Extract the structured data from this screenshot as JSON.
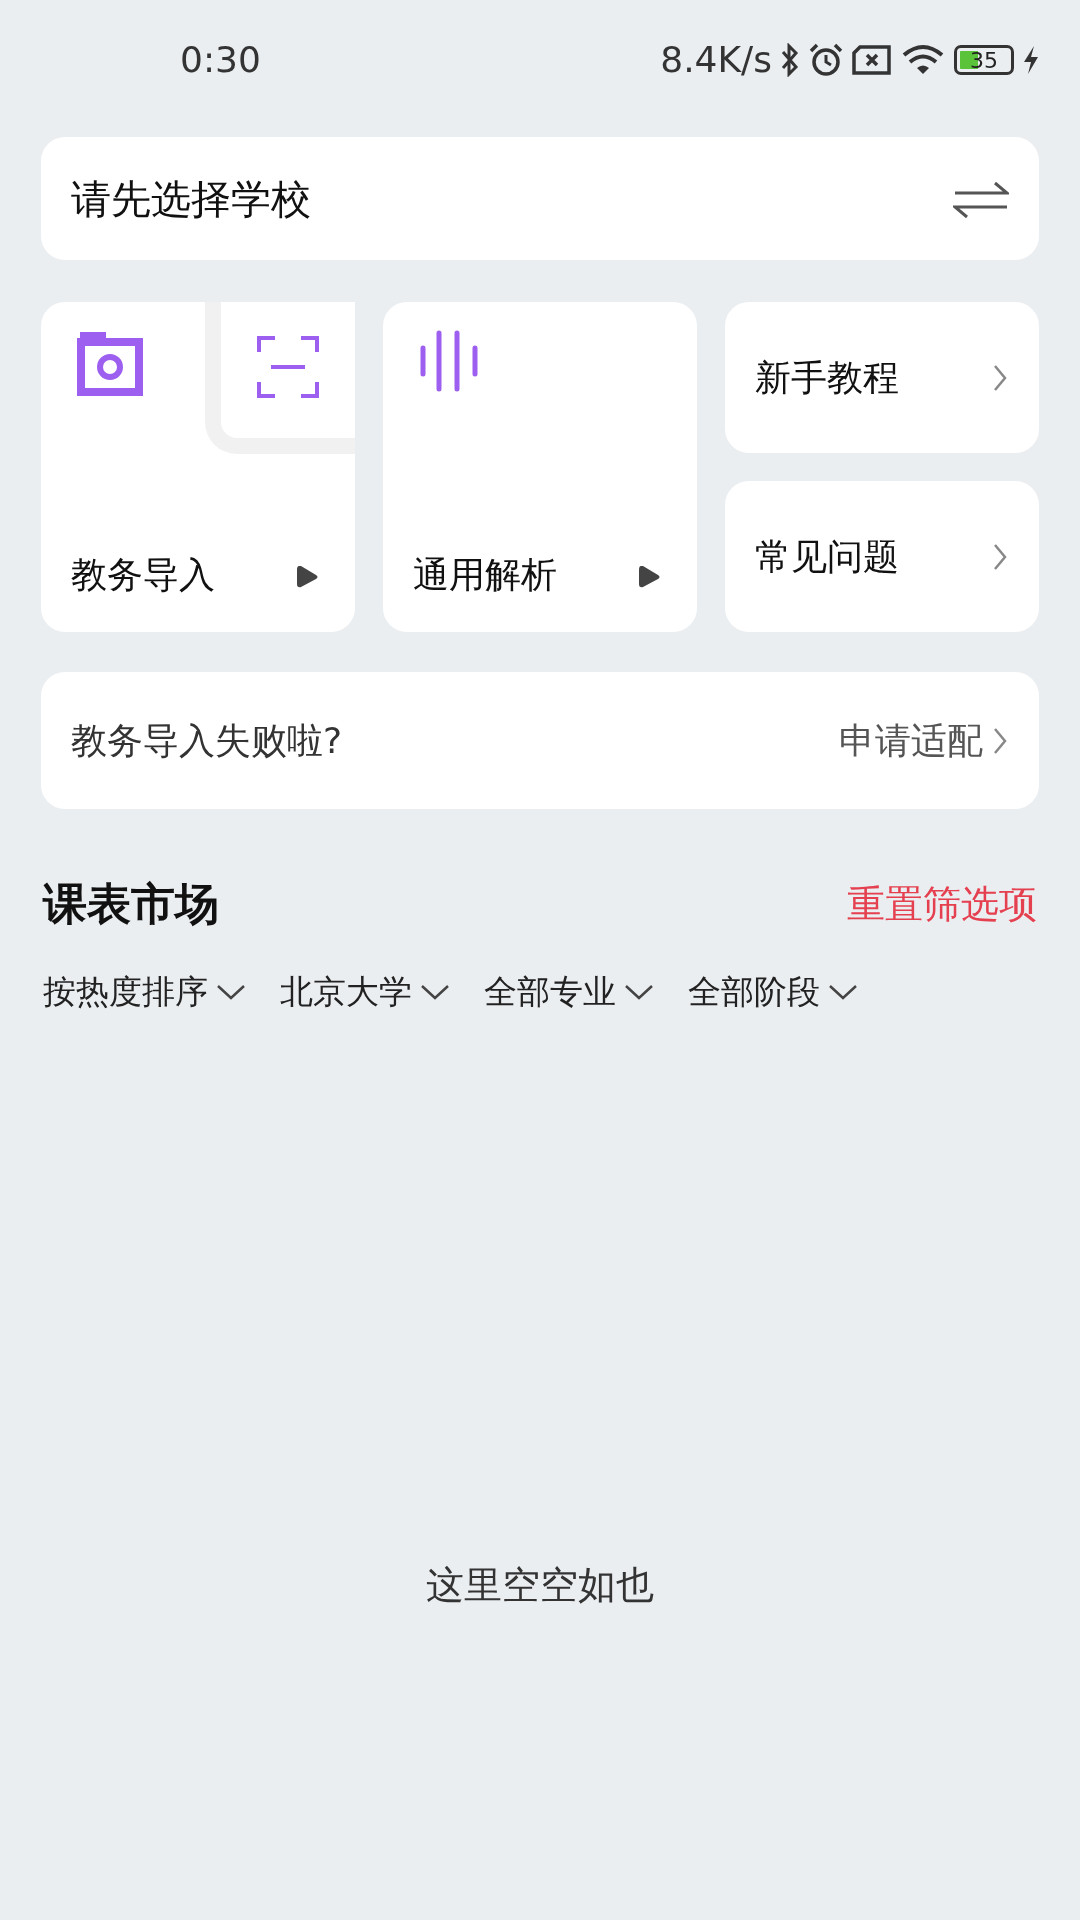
{
  "status_bar": {
    "time": "0:30",
    "speed": "8.4K/s",
    "battery": "35"
  },
  "school_selector": {
    "label": "请先选择学校"
  },
  "import_cards": [
    {
      "label": "教务导入",
      "kind": "camera"
    },
    {
      "label": "通用解析",
      "kind": "voice"
    }
  ],
  "help_links": [
    {
      "label": "新手教程"
    },
    {
      "label": "常见问题"
    }
  ],
  "fail_banner": {
    "text": "教务导入失败啦?",
    "action": "申请适配"
  },
  "market": {
    "title": "课表市场",
    "reset": "重置筛选项",
    "filters": [
      {
        "label": "按热度排序"
      },
      {
        "label": "北京大学"
      },
      {
        "label": "全部专业"
      },
      {
        "label": "全部阶段"
      }
    ],
    "empty_text": "这里空空如也"
  }
}
